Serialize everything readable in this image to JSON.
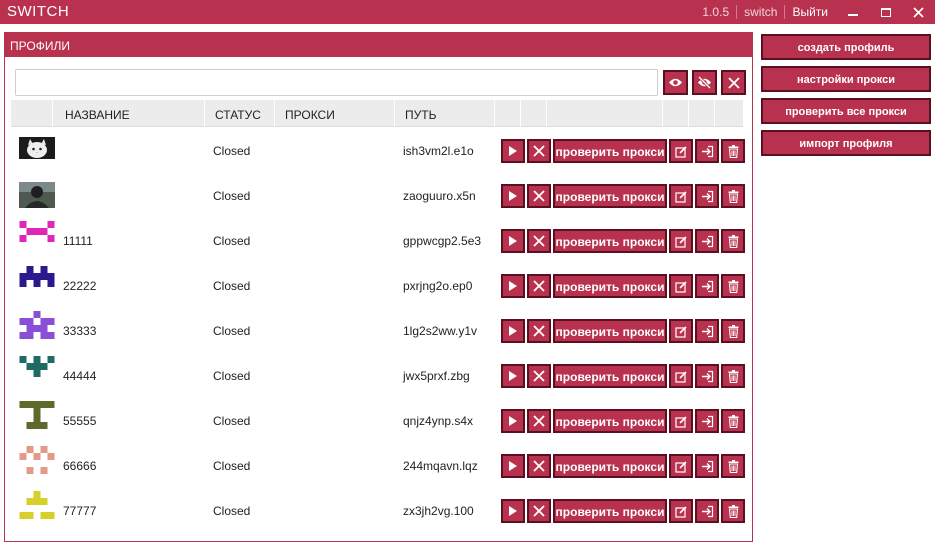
{
  "app": {
    "title": "SWITCH",
    "version": "1.0.5",
    "user": "switch",
    "logout_label": "Выйти"
  },
  "colors": {
    "accent": "#b8324f",
    "accent_border": "#5a1020"
  },
  "panel": {
    "header": "ПРОФИЛИ",
    "search_value": "",
    "columns": [
      "НАЗВАНИЕ",
      "СТАТУС",
      "ПРОКСИ",
      "ПУТЬ"
    ]
  },
  "check_label": "проверить прокси",
  "sidebar": {
    "create": "создать профиль",
    "proxy_settings": "настройки прокси",
    "check_all": "проверить все прокси",
    "import": "импорт профиля"
  },
  "profiles": [
    {
      "name": "",
      "status": "Closed",
      "proxy": "",
      "path": "ish3vm2l.e1o",
      "avatar": "cat-photo",
      "color": ""
    },
    {
      "name": "",
      "status": "Closed",
      "proxy": "",
      "path": "zaoguuro.x5n",
      "avatar": "soldier-photo",
      "color": ""
    },
    {
      "name": "11111",
      "status": "Closed",
      "proxy": "",
      "path": "gppwcgp2.5e3",
      "avatar": "identicon",
      "color": "#e026b8"
    },
    {
      "name": "22222",
      "status": "Closed",
      "proxy": "",
      "path": "pxrjng2o.ep0",
      "avatar": "identicon",
      "color": "#2a1a8e"
    },
    {
      "name": "33333",
      "status": "Closed",
      "proxy": "",
      "path": "1lg2s2ww.y1v",
      "avatar": "identicon",
      "color": "#8a4fd6"
    },
    {
      "name": "44444",
      "status": "Closed",
      "proxy": "",
      "path": "jwx5prxf.zbg",
      "avatar": "identicon",
      "color": "#1e6b64"
    },
    {
      "name": "55555",
      "status": "Closed",
      "proxy": "",
      "path": "qnjz4ynp.s4x",
      "avatar": "identicon",
      "color": "#5e6a2c"
    },
    {
      "name": "66666",
      "status": "Closed",
      "proxy": "",
      "path": "244mqavn.lqz",
      "avatar": "identicon",
      "color": "#e39a86"
    },
    {
      "name": "77777",
      "status": "Closed",
      "proxy": "",
      "path": "zx3jh2vg.100",
      "avatar": "identicon",
      "color": "#d6d02a"
    }
  ]
}
